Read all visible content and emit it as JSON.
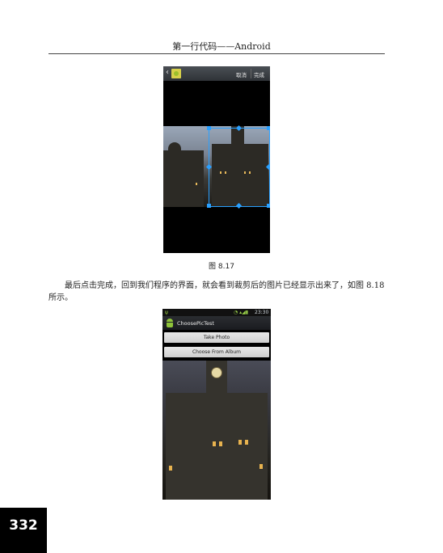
{
  "header": {
    "title": "第一行代码——Android"
  },
  "figure1": {
    "action_bar": {
      "cancel_label": "取消",
      "done_label": "完成"
    },
    "caption": "图    8.17"
  },
  "body_text": "最后点击完成，回到我们程序的界面，就会看到裁剪后的图片已经显示出来了，如图 8.18 所示。",
  "figure2": {
    "status_bar": {
      "time": "23:30"
    },
    "app_title": "ChoosePicTest",
    "buttons": {
      "take_photo": "Take Photo",
      "choose_from_album": "Choose From Album"
    }
  },
  "page_number": "332",
  "icons": {
    "back": "back-arrow-icon",
    "gallery": "gallery-app-icon",
    "android": "android-icon"
  },
  "colors": {
    "crop_accent": "#2aa0ff"
  }
}
